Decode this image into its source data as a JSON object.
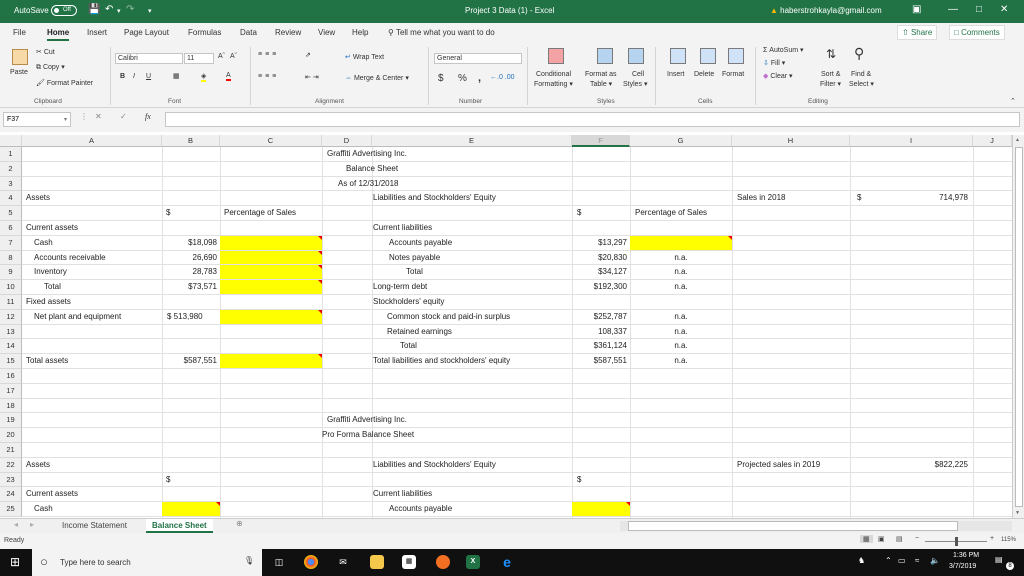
{
  "titlebar": {
    "autosave_label": "AutoSave",
    "autosave_state": "Off",
    "title": "Project 3 Data (1)  -  Excel",
    "user_email": "haberstrohkayla@gmail.com"
  },
  "menu": {
    "tabs": [
      "File",
      "Home",
      "Insert",
      "Page Layout",
      "Formulas",
      "Data",
      "Review",
      "View",
      "Help"
    ],
    "active_tab": "Home",
    "tell_me_placeholder": "Tell me what you want to do",
    "share_label": "Share",
    "comments_label": "Comments"
  },
  "ribbon": {
    "clipboard": {
      "paste": "Paste",
      "cut": "Cut",
      "copy": "Copy",
      "format_painter": "Format Painter",
      "label": "Clipboard"
    },
    "font": {
      "name": "Calibri",
      "size": "11",
      "bold": "B",
      "italic": "I",
      "underline": "U",
      "label": "Font",
      "highlight_color": "#ffff00",
      "font_color": "#ff0000"
    },
    "alignment": {
      "wrap_text": "Wrap Text",
      "merge_center": "Merge & Center",
      "label": "Alignment"
    },
    "number": {
      "format": "General",
      "currency": "$",
      "percent": "%",
      "comma": ",",
      "label": "Number"
    },
    "styles": {
      "conditional": "Conditional",
      "formatting": "Formatting",
      "format_as": "Format as",
      "table": "Table",
      "cell": "Cell",
      "styles": "Styles",
      "label": "Styles"
    },
    "cells": {
      "insert": "Insert",
      "delete": "Delete",
      "format": "Format",
      "label": "Cells"
    },
    "editing": {
      "autosum": "AutoSum",
      "fill": "Fill",
      "clear": "Clear",
      "sort_filter_1": "Sort &",
      "sort_filter_2": "Filter",
      "find_select_1": "Find &",
      "find_select_2": "Select",
      "label": "Editing"
    }
  },
  "formula_bar": {
    "name_box": "F37",
    "fx": "fx",
    "formula": ""
  },
  "sheet": {
    "columns": [
      "A",
      "B",
      "C",
      "D",
      "E",
      "F",
      "G",
      "H",
      "I",
      "J"
    ],
    "selected_column": "F",
    "rows": [
      "1",
      "2",
      "3",
      "4",
      "5",
      "6",
      "7",
      "8",
      "9",
      "10",
      "11",
      "12",
      "13",
      "14",
      "15",
      "16",
      "17",
      "18",
      "19",
      "20",
      "21",
      "22",
      "23",
      "24",
      "25"
    ],
    "cells": {
      "D1": "Graffiti Advertising Inc.",
      "D2": "Balance Sheet",
      "D3": "As of 12/31/2018",
      "A4": "Assets",
      "E4": "Liabilities and Stockholders' Equity",
      "H4": "Sales in 2018",
      "I4_sym": "$",
      "I4": "714,978",
      "B5": "$",
      "C5": "Percentage of Sales",
      "F5": "$",
      "G5": "Percentage of Sales",
      "A6": "Current assets",
      "E6": "Current liabilities",
      "A7": "Cash",
      "B7": "$18,098",
      "E7": "Accounts payable",
      "F7": "$13,297",
      "A8": "Accounts receivable",
      "B8": "26,690",
      "E8": "Notes payable",
      "F8": "$20,830",
      "G8": "n.a.",
      "A9": "Inventory",
      "B9": "28,783",
      "E9": "Total",
      "F9": "$34,127",
      "G9": "n.a.",
      "A10": "Total",
      "B10": "$73,571",
      "E10": "Long-term debt",
      "F10": "$192,300",
      "G10": "n.a.",
      "A11": "Fixed assets",
      "E11": "Stockholders' equity",
      "A12": "Net plant and equipment",
      "B12": "$ 513,980",
      "E12": "Common stock and paid-in surplus",
      "F12": "$252,787",
      "G12": "n.a.",
      "E13": "Retained earnings",
      "F13": "108,337",
      "G13": "n.a.",
      "E14": "Total",
      "F14": "$361,124",
      "G14": "n.a.",
      "A15": "Total assets",
      "B15": "$587,551",
      "E15": "Total liabilities and stockholders' equity",
      "F15": "$587,551",
      "G15": "n.a.",
      "D19": "Graffiti Advertising Inc.",
      "D20": "Pro Forma Balance Sheet",
      "A22": "Assets",
      "E22": "Liabilities and Stockholders' Equity",
      "H22": "Projected sales in 2019",
      "I22": "$822,225",
      "B23": "$",
      "F23": "$",
      "A24": "Current assets",
      "E24": "Current liabilities",
      "A25": "Cash",
      "E25": "Accounts payable"
    },
    "highlight_color": "#ffff00",
    "highlighted_cells": [
      "C7",
      "C8",
      "C9",
      "C10",
      "C12",
      "C15",
      "G7",
      "B25",
      "F25"
    ]
  },
  "sheet_tabs": [
    "Income Statement",
    "Balance Sheet"
  ],
  "active_sheet": "Balance Sheet",
  "status": {
    "ready": "Ready",
    "zoom": "115%"
  },
  "taskbar": {
    "search_placeholder": "Type here to search",
    "time": "1:36 PM",
    "date": "3/7/2019",
    "notifications": "8"
  }
}
